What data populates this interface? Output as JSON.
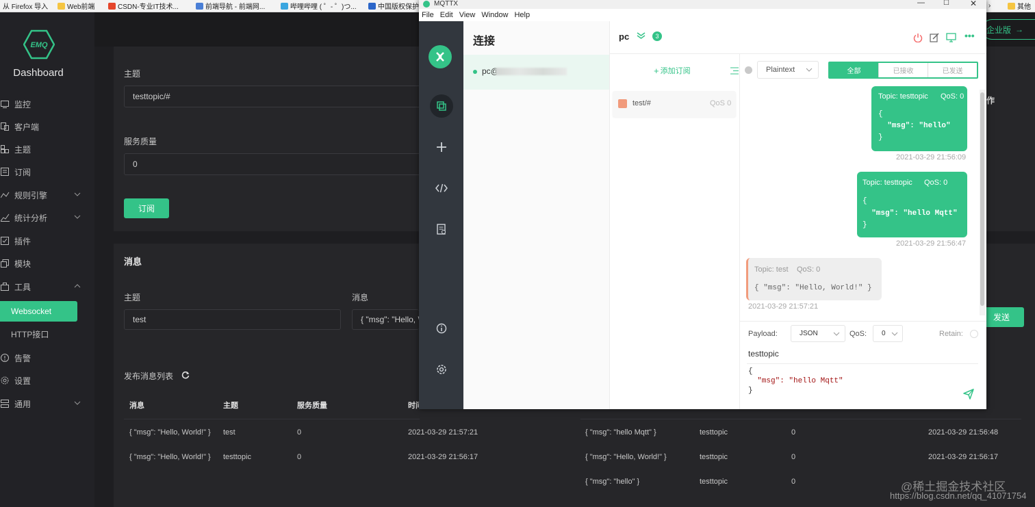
{
  "browser": {
    "bookmarks": [
      "从 Firefox 导入",
      "Web前端",
      "CSDN-专业IT技术...",
      "前端导航 - 前端网...",
      "哔哩哔哩 ( ゜- ゜)つ...",
      "中国版权保护...",
      "其他"
    ]
  },
  "emq": {
    "logo_text": "EMQ",
    "title": "Dashboard",
    "enterprise_btn": "企业版",
    "nav": [
      {
        "label": "监控",
        "icon": "monitor-icon"
      },
      {
        "label": "客户端",
        "icon": "clients-icon"
      },
      {
        "label": "主题",
        "icon": "topics-icon"
      },
      {
        "label": "订阅",
        "icon": "subscriptions-icon"
      },
      {
        "label": "规则引擎",
        "icon": "rule-engine-icon"
      },
      {
        "label": "统计分析",
        "icon": "analytics-icon"
      },
      {
        "label": "插件",
        "icon": "plugins-icon"
      },
      {
        "label": "模块",
        "icon": "modules-icon"
      },
      {
        "label": "工具",
        "icon": "tools-icon"
      },
      {
        "label": "Websocket"
      },
      {
        "label": "HTTP接口"
      },
      {
        "label": "告警",
        "icon": "alarm-icon"
      },
      {
        "label": "设置",
        "icon": "settings-icon"
      },
      {
        "label": "通用",
        "icon": "general-icon"
      }
    ],
    "subscribe": {
      "topic_label": "主题",
      "topic_value": "testtopic/#",
      "qos_label": "服务质量",
      "qos_value": "0",
      "button": "订阅",
      "ops_header_fragment": "作"
    },
    "message": {
      "title": "消息",
      "topic_label": "主题",
      "topic_value": "test",
      "msg_label": "消息",
      "msg_value": "{ \"msg\": \"Hello, W",
      "send_button": "发送"
    },
    "published_list": {
      "title": "发布消息列表",
      "headers": [
        "消息",
        "主题",
        "服务质量",
        "时间"
      ],
      "rows": [
        {
          "msg": "{ \"msg\": \"Hello, World!\" }",
          "topic": "test",
          "qos": "0",
          "time": "2021-03-29 21:57:21"
        },
        {
          "msg": "{ \"msg\": \"Hello, World!\" }",
          "topic": "testtopic",
          "qos": "0",
          "time": "2021-03-29 21:56:17"
        }
      ]
    },
    "received_list": {
      "rows": [
        {
          "msg": "{ \"msg\": \"hello Mqtt\" }",
          "topic": "testtopic",
          "qos": "0",
          "time": "2021-03-29 21:56:48"
        },
        {
          "msg": "{ \"msg\": \"Hello, World!\" }",
          "topic": "testtopic",
          "qos": "0",
          "time": "2021-03-29 21:56:17"
        },
        {
          "msg": "{ \"msg\": \"hello\" }",
          "topic": "testtopic",
          "qos": "0",
          "time": ""
        }
      ]
    }
  },
  "mqttx": {
    "window_title": "MQTTX",
    "menu": [
      "File",
      "Edit",
      "View",
      "Window",
      "Help"
    ],
    "connections_title": "连接",
    "connection_name": "pc@",
    "header_name": "pc",
    "badge_count": "3",
    "add_subscription": "添加订阅",
    "subscription": {
      "topic": "test/#",
      "qos": "QoS 0"
    },
    "format_select": "Plaintext",
    "filter_tabs": [
      "全部",
      "已接收",
      "已发送"
    ],
    "messages": [
      {
        "dir": "out",
        "topic": "Topic: testtopic",
        "qos": "QoS: 0",
        "body": [
          "{",
          "  \"msg\": \"hello\"",
          "}"
        ],
        "time": "2021-03-29 21:56:09"
      },
      {
        "dir": "out",
        "topic": "Topic: testtopic",
        "qos": "QoS: 0",
        "body": [
          "{",
          "  \"msg\": \"hello Mqtt\"",
          "}"
        ],
        "time": "2021-03-29 21:56:47"
      },
      {
        "dir": "in",
        "topic": "Topic: test",
        "qos": "QoS: 0",
        "body": [
          "{ \"msg\": \"Hello, World!\" }"
        ],
        "time": "2021-03-29 21:57:21"
      }
    ],
    "composer": {
      "payload_label": "Payload:",
      "payload_type": "JSON",
      "qos_label": "QoS:",
      "qos_value": "0",
      "retain_label": "Retain:",
      "topic": "testtopic",
      "body": [
        "{",
        "  \"msg\": \"hello Mqtt\"",
        "}"
      ]
    },
    "colors": {
      "accent": "#34c388",
      "rail": "#32373e",
      "incoming_border": "#f19b7c"
    }
  },
  "watermark": {
    "line1": "@稀土掘金技术社区",
    "line2": "https://blog.csdn.net/qq_41071754"
  }
}
